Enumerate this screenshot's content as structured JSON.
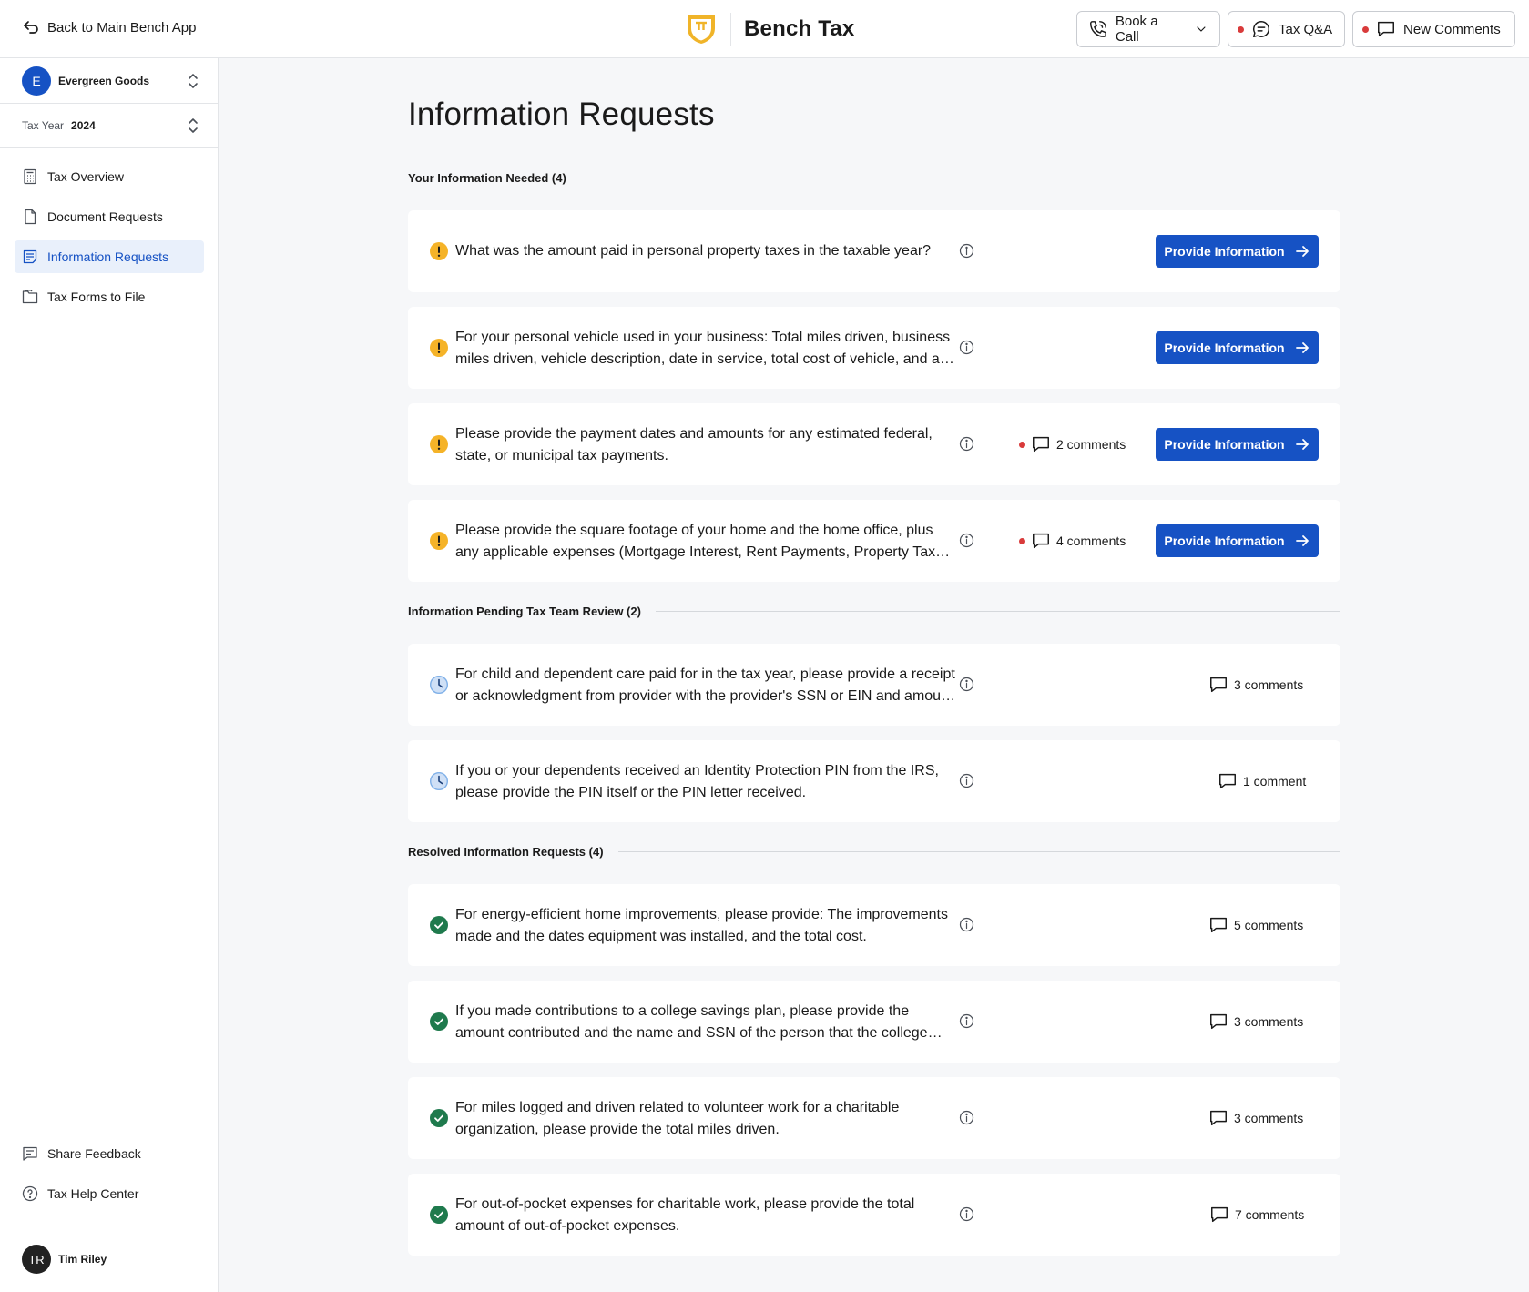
{
  "header": {
    "back_label": "Back to Main Bench App",
    "brand_name": "Bench Tax",
    "book_call_label": "Book a Call",
    "tax_qa_label": "Tax Q&A",
    "new_comments_label": "New Comments"
  },
  "sidebar": {
    "company": {
      "initial": "E",
      "name": "Evergreen Goods"
    },
    "tax_year": {
      "label": "Tax Year",
      "value": "2024"
    },
    "nav": [
      {
        "label": "Tax Overview"
      },
      {
        "label": "Document Requests"
      },
      {
        "label": "Information Requests"
      },
      {
        "label": "Tax Forms to File"
      }
    ],
    "bottom": [
      {
        "label": "Share Feedback"
      },
      {
        "label": "Tax Help Center"
      }
    ],
    "user": {
      "initials": "TR",
      "name": "Tim Riley"
    }
  },
  "main": {
    "title": "Information Requests",
    "provide_label": "Provide Information",
    "sections": [
      {
        "title": "Your Information Needed (4)",
        "items": [
          {
            "question": "What was the amount paid in personal property taxes in the taxable year?",
            "comments": ""
          },
          {
            "question": "For your personal vehicle used in your business: Total miles driven, business miles driven, vehicle description, date in service, total cost of vehicle, and any other related expenses.",
            "comments": ""
          },
          {
            "question": "Please provide the payment dates and amounts for any estimated federal, state, or municipal tax payments.",
            "comments": "2 comments"
          },
          {
            "question": "Please provide the square footage of your home and the home office, plus any applicable expenses (Mortgage Interest, Rent Payments, Property Taxes, Utilities, Insurance).",
            "comments": "4 comments"
          }
        ]
      },
      {
        "title": "Information Pending Tax Team Review (2)",
        "items": [
          {
            "question": "For child and dependent care paid for in the tax year, please provide a receipt or acknowledgment from provider with the provider's SSN or EIN and amount paid.",
            "comments": "3 comments"
          },
          {
            "question": "If you or your dependents received an Identity Protection PIN from the IRS, please provide the PIN itself or the PIN letter received.",
            "comments": "1 comment"
          }
        ]
      },
      {
        "title": "Resolved Information Requests (4)",
        "items": [
          {
            "question": "For energy-efficient home improvements, please provide: The improvements made and the dates equipment was installed, and the total cost.",
            "comments": "5 comments"
          },
          {
            "question": "If you made contributions to a college savings plan, please provide the amount contributed and the name and SSN of the person that the college savings plan is for.",
            "comments": "3 comments"
          },
          {
            "question": "For miles logged and driven related to volunteer work for a charitable organization, please provide the total miles driven.",
            "comments": "3 comments"
          },
          {
            "question": "For out-of-pocket expenses for charitable work, please provide the total amount of out-of-pocket expenses.",
            "comments": "7 comments"
          }
        ]
      }
    ]
  },
  "colors": {
    "accent": "#1652c4",
    "warning": "#f5b328",
    "pending": "#7fb0e8",
    "resolved": "#1f7a4d",
    "alert_dot": "#d93b3b"
  }
}
